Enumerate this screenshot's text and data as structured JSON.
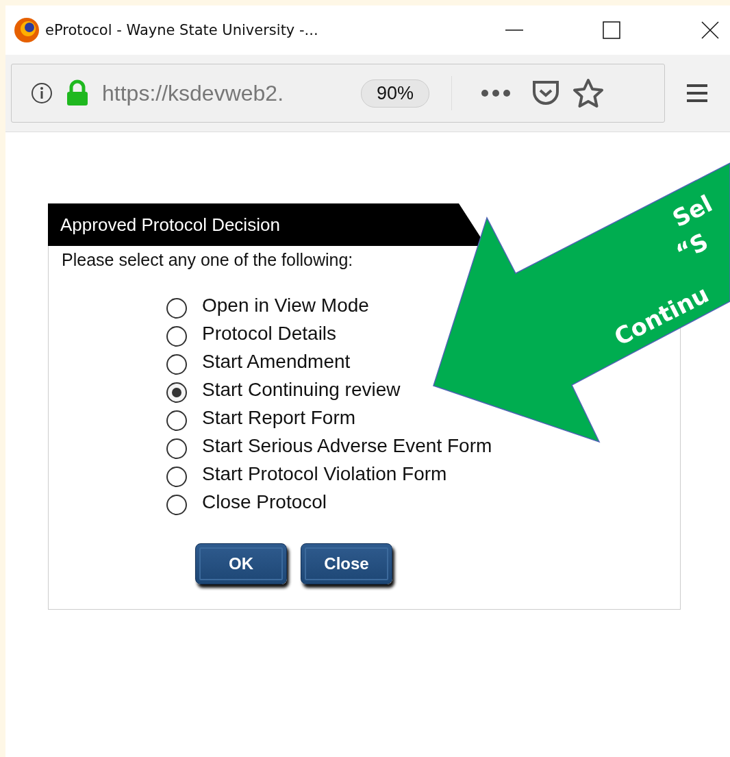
{
  "window": {
    "title": "eProtocol - Wayne State University -..."
  },
  "toolbar": {
    "url": "https://ksdevweb2.",
    "zoom": "90%"
  },
  "dialog": {
    "title": "Approved Protocol Decision",
    "prompt": "Please select any one of the following:",
    "options": [
      {
        "label": "Open in View Mode",
        "selected": false
      },
      {
        "label": "Protocol Details",
        "selected": false
      },
      {
        "label": "Start Amendment",
        "selected": false
      },
      {
        "label": "Start Continuing review",
        "selected": true
      },
      {
        "label": "Start Report Form",
        "selected": false
      },
      {
        "label": "Start Serious Adverse Event Form",
        "selected": false
      },
      {
        "label": "Start Protocol Violation Form",
        "selected": false
      },
      {
        "label": "Close Protocol",
        "selected": false
      }
    ],
    "buttons": [
      "OK",
      "Close"
    ]
  },
  "callout": {
    "lines": [
      "Sel",
      "“S",
      "Continu"
    ]
  }
}
